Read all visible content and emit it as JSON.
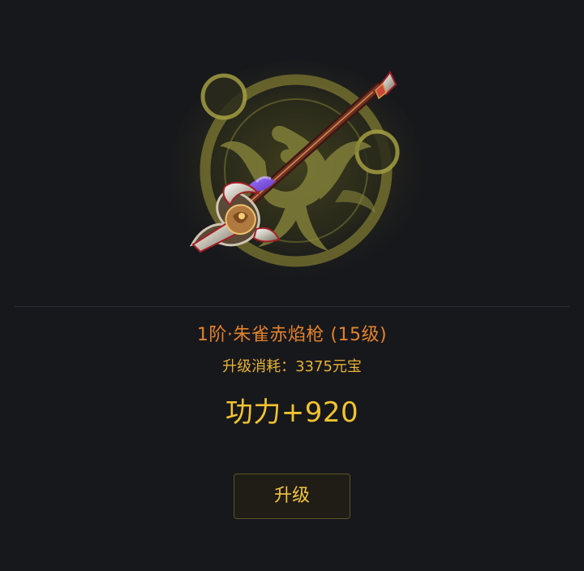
{
  "weapon": {
    "image_subject": "朱雀赤焰枪",
    "name": "1阶·朱雀赤焰枪 (15级)",
    "cost_label": "升级消耗：",
    "cost_value": "3375元宝",
    "power": "功力+920"
  },
  "actions": {
    "upgrade_label": "升级"
  },
  "colors": {
    "background": "#17181c",
    "name_orange": "#e3822c",
    "gold": "#f2c32e",
    "aura": "#9f9a38"
  },
  "icons": {
    "weapon": "phoenix-spear-icon",
    "emblem": "phoenix-emblem-icon"
  }
}
